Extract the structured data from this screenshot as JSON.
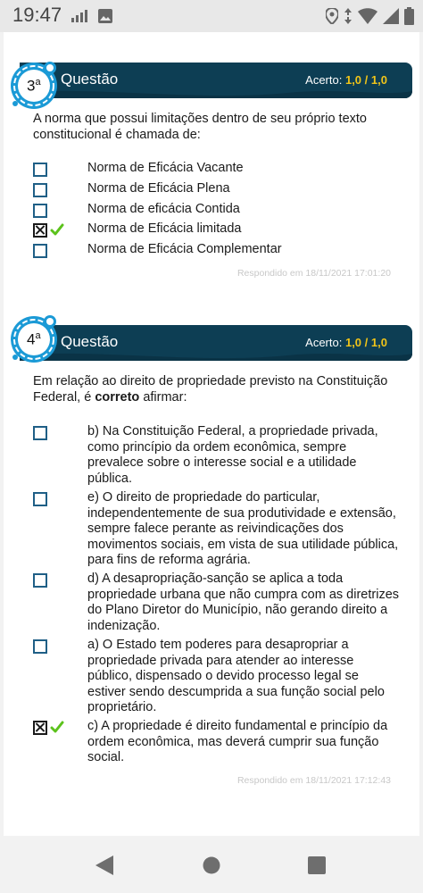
{
  "status_bar": {
    "time": "19:47",
    "icons_left": [
      "signal-bars-icon",
      "image-icon"
    ],
    "icons_right": [
      "location-icon",
      "data-arrows-icon",
      "wifi-icon",
      "cell-signal-icon",
      "battery-icon"
    ]
  },
  "questions": [
    {
      "number": "3",
      "number_suffix": "a",
      "title": "Questão",
      "score_label": "Acerto:",
      "score_value": "1,0",
      "score_separator": "/",
      "score_total": "1,0",
      "prompt": "A norma que possui limitações dentro de seu próprio texto constitucional é chamada de:",
      "options": [
        {
          "text": "Norma de Eficácia Vacante",
          "checked": false,
          "correct": false
        },
        {
          "text": "Norma de Eficácia Plena",
          "checked": false,
          "correct": false
        },
        {
          "text": "Norma de eficácia Contida",
          "checked": false,
          "correct": false
        },
        {
          "text": "Norma de Eficácia limitada",
          "checked": true,
          "correct": true
        },
        {
          "text": "Norma de Eficácia Complementar",
          "checked": false,
          "correct": false
        }
      ],
      "answered_at": "Respondido em 18/11/2021 17:01:20"
    },
    {
      "number": "4",
      "number_suffix": "a",
      "title": "Questão",
      "score_label": "Acerto:",
      "score_value": "1,0",
      "score_separator": "/",
      "score_total": "1,0",
      "prompt_before": "Em relação ao direito de propriedade previsto na Constituição Federal, é ",
      "prompt_bold": "correto",
      "prompt_after": " afirmar:",
      "options": [
        {
          "text": "b) Na Constituição Federal, a propriedade privada, como princípio da ordem econômica, sempre prevalece sobre o interesse social e a utilidade pública.",
          "checked": false,
          "correct": false
        },
        {
          "text": "e) O direito de propriedade do particular, independentemente de sua produtividade e extensão, sempre falece perante as reivindicações dos movimentos sociais, em vista de sua utilidade pública, para fins de reforma agrária.",
          "checked": false,
          "correct": false
        },
        {
          "text": "d) A desapropriação-sanção se aplica a toda propriedade urbana que não cumpra com as diretrizes do Plano Diretor do Município, não gerando direito a indenização.",
          "checked": false,
          "correct": false
        },
        {
          "text": "a) O Estado tem poderes para desapropriar a propriedade privada para atender ao interesse público, dispensado o devido processo legal se estiver sendo descumprida a sua função social pelo proprietário.",
          "checked": false,
          "correct": false
        },
        {
          "text": "c) A propriedade é direito fundamental e princípio da ordem econômica, mas deverá cumprir sua função social.",
          "checked": true,
          "correct": true
        }
      ],
      "answered_at": "Respondido em 18/11/2021 17:12:43"
    }
  ],
  "nav_bar": {
    "buttons": [
      "back-icon",
      "home-icon",
      "recents-icon"
    ]
  },
  "colors": {
    "header_bg": "#0d3e54",
    "score_value": "#f0c419",
    "checkbox_border": "#1f5f86",
    "tick": "#5cc21c",
    "badge_ring": "#1b9ad6"
  }
}
